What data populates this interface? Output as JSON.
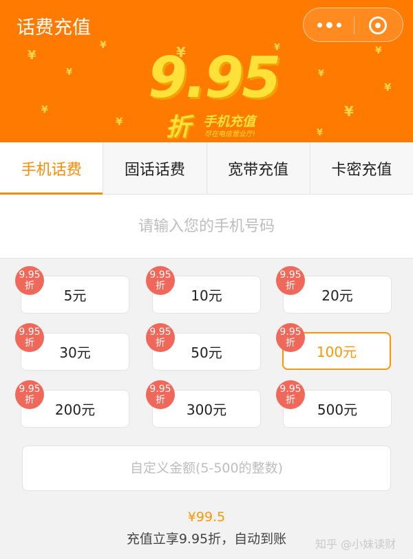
{
  "header": {
    "title": "话费充值",
    "capsule": {
      "more_icon": "more-dots-icon",
      "close_icon": "circle-close-icon"
    }
  },
  "banner": {
    "rate": "9.95",
    "unit": "折",
    "title": "手机充值",
    "subtitle": "尽在电信营业厅!",
    "colors": {
      "background": "#ff7a00",
      "accent": "#ffe13a"
    }
  },
  "tabs": [
    {
      "label": "手机话费",
      "active": true
    },
    {
      "label": "固话话费",
      "active": false
    },
    {
      "label": "宽带充值",
      "active": false
    },
    {
      "label": "卡密充值",
      "active": false
    }
  ],
  "phone": {
    "placeholder": "请输入您的手机号码"
  },
  "amounts": [
    {
      "label": "5元",
      "badge_line1": "9.95",
      "badge_line2": "折",
      "selected": false
    },
    {
      "label": "10元",
      "badge_line1": "9.95",
      "badge_line2": "折",
      "selected": false
    },
    {
      "label": "20元",
      "badge_line1": "9.95",
      "badge_line2": "折",
      "selected": false
    },
    {
      "label": "30元",
      "badge_line1": "9.95",
      "badge_line2": "折",
      "selected": false
    },
    {
      "label": "50元",
      "badge_line1": "9.95",
      "badge_line2": "折",
      "selected": false
    },
    {
      "label": "100元",
      "badge_line1": "9.95",
      "badge_line2": "折",
      "selected": true
    },
    {
      "label": "200元",
      "badge_line1": "9.95",
      "badge_line2": "折",
      "selected": false
    },
    {
      "label": "300元",
      "badge_line1": "9.95",
      "badge_line2": "折",
      "selected": false
    },
    {
      "label": "500元",
      "badge_line1": "9.95",
      "badge_line2": "折",
      "selected": false
    }
  ],
  "custom": {
    "placeholder": "自定义金额(5-500的整数)"
  },
  "summary": {
    "price": "¥99.5",
    "note": "充值立享9.95折，自动到账"
  },
  "watermark": "知乎 @小妹读财"
}
